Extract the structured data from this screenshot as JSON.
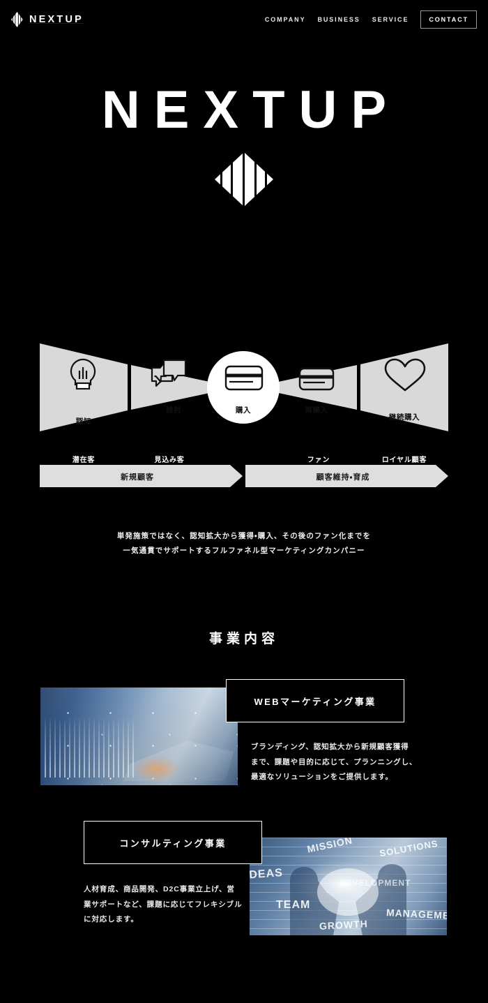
{
  "header": {
    "logo_text": "NEXTUP",
    "logo_icon": "nextup-diamond-mark",
    "nav": [
      {
        "label": "COMPANY",
        "name": "nav-company"
      },
      {
        "label": "BUSINESS",
        "name": "nav-business"
      },
      {
        "label": "SERVICE",
        "name": "nav-service"
      }
    ],
    "cta": {
      "label": "CONTACT",
      "name": "nav-contact"
    }
  },
  "hero": {
    "title": "NEXTUP",
    "emblem_icon": "nextup-diamond-emblem"
  },
  "funnel": {
    "stages": [
      {
        "icon": "lightbulb-icon",
        "label": "認知",
        "caption": "潜在客"
      },
      {
        "icon": "chat-bubbles-icon",
        "label": "検討",
        "caption": "見込み客"
      },
      {
        "icon": "credit-card-icon",
        "label": "購入",
        "caption": ""
      },
      {
        "icon": "credit-card-icon",
        "label": "再購入",
        "caption": "ファン"
      },
      {
        "icon": "heart-icon",
        "label": "継続購入",
        "caption": "ロイヤル顧客"
      }
    ],
    "bars": [
      {
        "label": "新規顧客"
      },
      {
        "label": "顧客維持・育成"
      }
    ],
    "colors": {
      "shape": "#d9d9d9",
      "highlight": "#ffffff",
      "text": "#111111"
    }
  },
  "lead": {
    "line1": "単発施策ではなく、認知拡大から獲得・購入、その後のファン化までを",
    "line2": "一気通貫でサポートするフルファネル型マーケティングカンパニー"
  },
  "business": {
    "section_title": "事業内容",
    "cards": [
      {
        "title": "WEBマーケティング事業",
        "image_alt": "businessman-typing-on-laptop-with-data-chart-overlay",
        "desc_lines": [
          "ブランディング、認知拡大から新規顧客獲得",
          "まで、課題や目的に応じて、プランニングし、",
          "最適なソリューションをご提供します。"
        ]
      },
      {
        "title": "コンサルティング事業",
        "image_alt": "handshake-with-business-keyword-overlay",
        "image_words": [
          "IDEAS",
          "MISSION",
          "SOLUTIONS",
          "DEVELOPMENT",
          "TEAM",
          "MANAGEMENT",
          "GROWTH"
        ],
        "desc_lines": [
          "人材育成、商品開発、D2C事業立上げ、営",
          "業サポートなど、課題に応じてフレキシブル",
          "に対応します。"
        ]
      }
    ]
  },
  "theme": {
    "background": "#000000",
    "text": "#ffffff",
    "funnel_gray": "#d9d9d9"
  }
}
